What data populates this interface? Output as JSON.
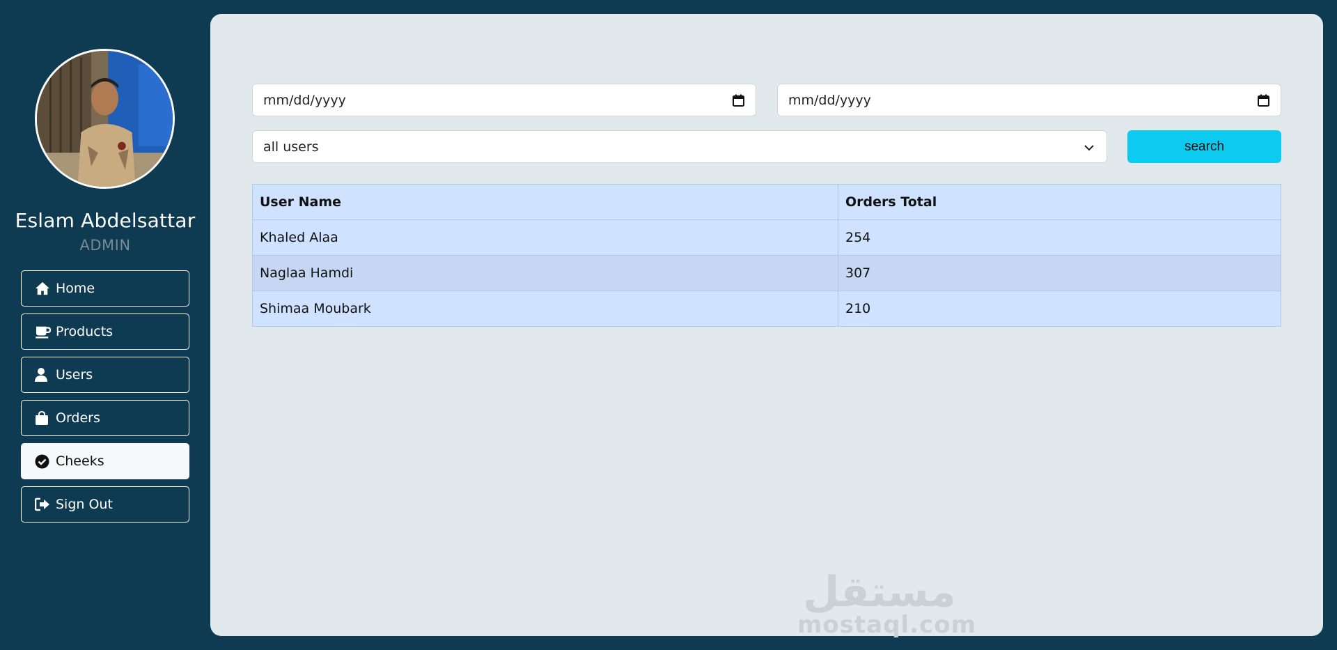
{
  "profile": {
    "name": "Eslam Abdelsattar",
    "role": "ADMIN"
  },
  "nav": {
    "items": [
      {
        "label": "Home",
        "icon": "home-icon"
      },
      {
        "label": "Products",
        "icon": "coffee-cup-icon"
      },
      {
        "label": "Users",
        "icon": "user-icon"
      },
      {
        "label": "Orders",
        "icon": "shopping-bag-icon"
      },
      {
        "label": "Cheeks",
        "icon": "check-circle-icon",
        "active": true
      },
      {
        "label": "Sign Out",
        "icon": "sign-out-icon"
      }
    ]
  },
  "filters": {
    "date_from_placeholder": "mm/dd/yyyy",
    "date_to_placeholder": "mm/dd/yyyy",
    "user_select_value": "all users",
    "search_label": "search"
  },
  "table": {
    "headers": [
      "User Name",
      "Orders Total"
    ],
    "rows": [
      [
        "Khaled Alaa",
        "254"
      ],
      [
        "Naglaa Hamdi",
        "307"
      ],
      [
        "Shimaa Moubark",
        "210"
      ]
    ]
  },
  "watermark": {
    "arabic": "مستقل",
    "latin": "mostaql.com"
  },
  "colors": {
    "background": "#0e3b52",
    "panel": "#e2e9ed",
    "accent": "#0dcaf0",
    "table_row": "#cfe2ff"
  }
}
